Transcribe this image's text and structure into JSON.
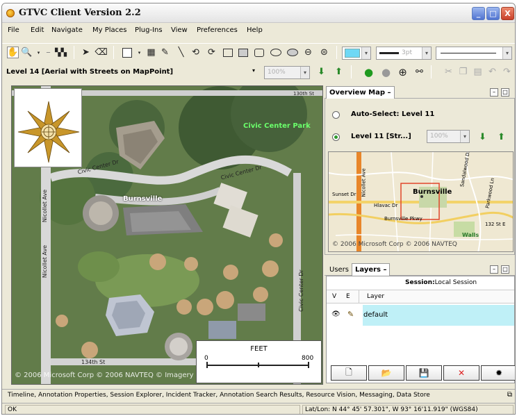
{
  "window": {
    "title": "GTVC Client Version 2.2",
    "controls": {
      "minimize": "_",
      "maximize": "□",
      "close": "X"
    }
  },
  "menu": {
    "items": [
      "File",
      "Edit",
      "Navigate",
      "My Places",
      "Plug-Ins",
      "View",
      "Preferences",
      "Help"
    ]
  },
  "toolbar": {
    "fill_color": "#6fd8f5",
    "line_width": "3pt",
    "level_label": "Level 14  [Aerial with Streets on MapPoint]",
    "zoom_value": "100%"
  },
  "map": {
    "labels": {
      "burnsville": "Burnsville",
      "civic_center_park": "Civic Center Park",
      "civic_center_dr_1": "Civic Center Dr",
      "civic_center_dr_2": "Civic Center Dr",
      "civic_center_dr_3": "Civic Center Dr",
      "nicollet_ave_1": "Nicollet Ave",
      "nicollet_ave_2": "Nicollet Ave",
      "street_130th": "130th St",
      "street_134th": "134th St"
    },
    "copyright": "© 2006 Microsoft Corp © 2006 NAVTEQ © Imagery",
    "scale": {
      "unit": "FEET",
      "start": "0",
      "end": "800"
    }
  },
  "overview": {
    "tab_label": "Overview Map",
    "auto_select_label": "Auto-Select: Level 11",
    "level_label": "Level 11  [Str...]",
    "zoom_value": "100%",
    "map_place": "Burnsville",
    "map_labels": {
      "nicollet_ave": "Nicollet Ave",
      "hlavac_dr": "Hlavac Dr",
      "burnsville_pkwy": "Burnsville Pkwy",
      "sunset_dr": "Sunset Dr",
      "sandalwood": "Sandalwood Dr",
      "tilted": "Parkwood Ln",
      "walls": "Walls",
      "street_132nd": "132 St E"
    },
    "copyright": "© 2006 Microsoft Corp © 2006 NAVTEQ"
  },
  "layers_panel": {
    "tabs": [
      "Users",
      "Layers"
    ],
    "session_label": "Session:",
    "session_value": "Local Session",
    "columns": [
      "V",
      "E",
      "Layer"
    ],
    "rows": [
      {
        "layer": "default"
      }
    ]
  },
  "docked_tabs": "Timeline, Annotation Properties, Session Explorer, Incident Tracker, Annotation Search Results, Resource Vision, Messaging, Data Store",
  "status": {
    "message": "OK",
    "latlon": "Lat/Lon: N 44° 45' 57.301\", W 93° 16'11.919\" (WGS84)"
  }
}
